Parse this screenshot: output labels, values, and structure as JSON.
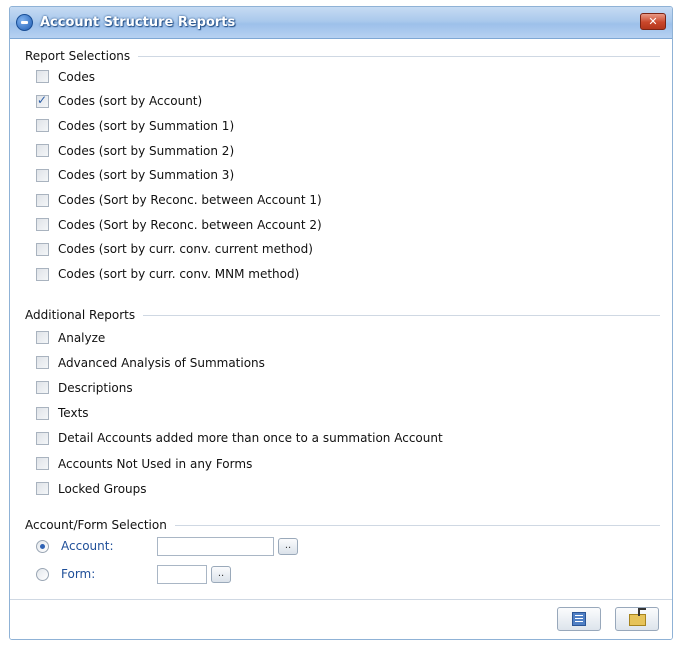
{
  "window": {
    "title": "Account Structure Reports",
    "close_label": "✕"
  },
  "report_selections": {
    "header": "Report Selections",
    "items": [
      {
        "label": "Codes",
        "checked": false
      },
      {
        "label": "Codes (sort by Account)",
        "checked": true
      },
      {
        "label": "Codes (sort by Summation 1)",
        "checked": false
      },
      {
        "label": "Codes (sort by Summation 2)",
        "checked": false
      },
      {
        "label": "Codes (sort by Summation 3)",
        "checked": false
      },
      {
        "label": "Codes (Sort by Reconc. between Account 1)",
        "checked": false
      },
      {
        "label": "Codes (Sort by Reconc. between Account 2)",
        "checked": false
      },
      {
        "label": "Codes (sort by curr. conv. current method)",
        "checked": false
      },
      {
        "label": "Codes (sort by curr. conv. MNM method)",
        "checked": false
      }
    ]
  },
  "additional_reports": {
    "header": "Additional Reports",
    "items": [
      {
        "label": "Analyze",
        "checked": false
      },
      {
        "label": "Advanced Analysis of Summations",
        "checked": false
      },
      {
        "label": "Descriptions",
        "checked": false
      },
      {
        "label": "Texts",
        "checked": false
      },
      {
        "label": "Detail Accounts added more than once to a summation Account",
        "checked": false
      },
      {
        "label": "Accounts Not Used in any Forms",
        "checked": false
      },
      {
        "label": "Locked Groups",
        "checked": false
      }
    ]
  },
  "account_form_selection": {
    "header": "Account/Form Selection",
    "account_label": "Account:",
    "account_value": "",
    "account_selected": true,
    "form_label": "Form:",
    "form_value": "",
    "form_selected": false,
    "browse_label": ".."
  },
  "footer": {
    "print_icon": "report-icon",
    "exit_icon": "folder-exit-icon"
  }
}
